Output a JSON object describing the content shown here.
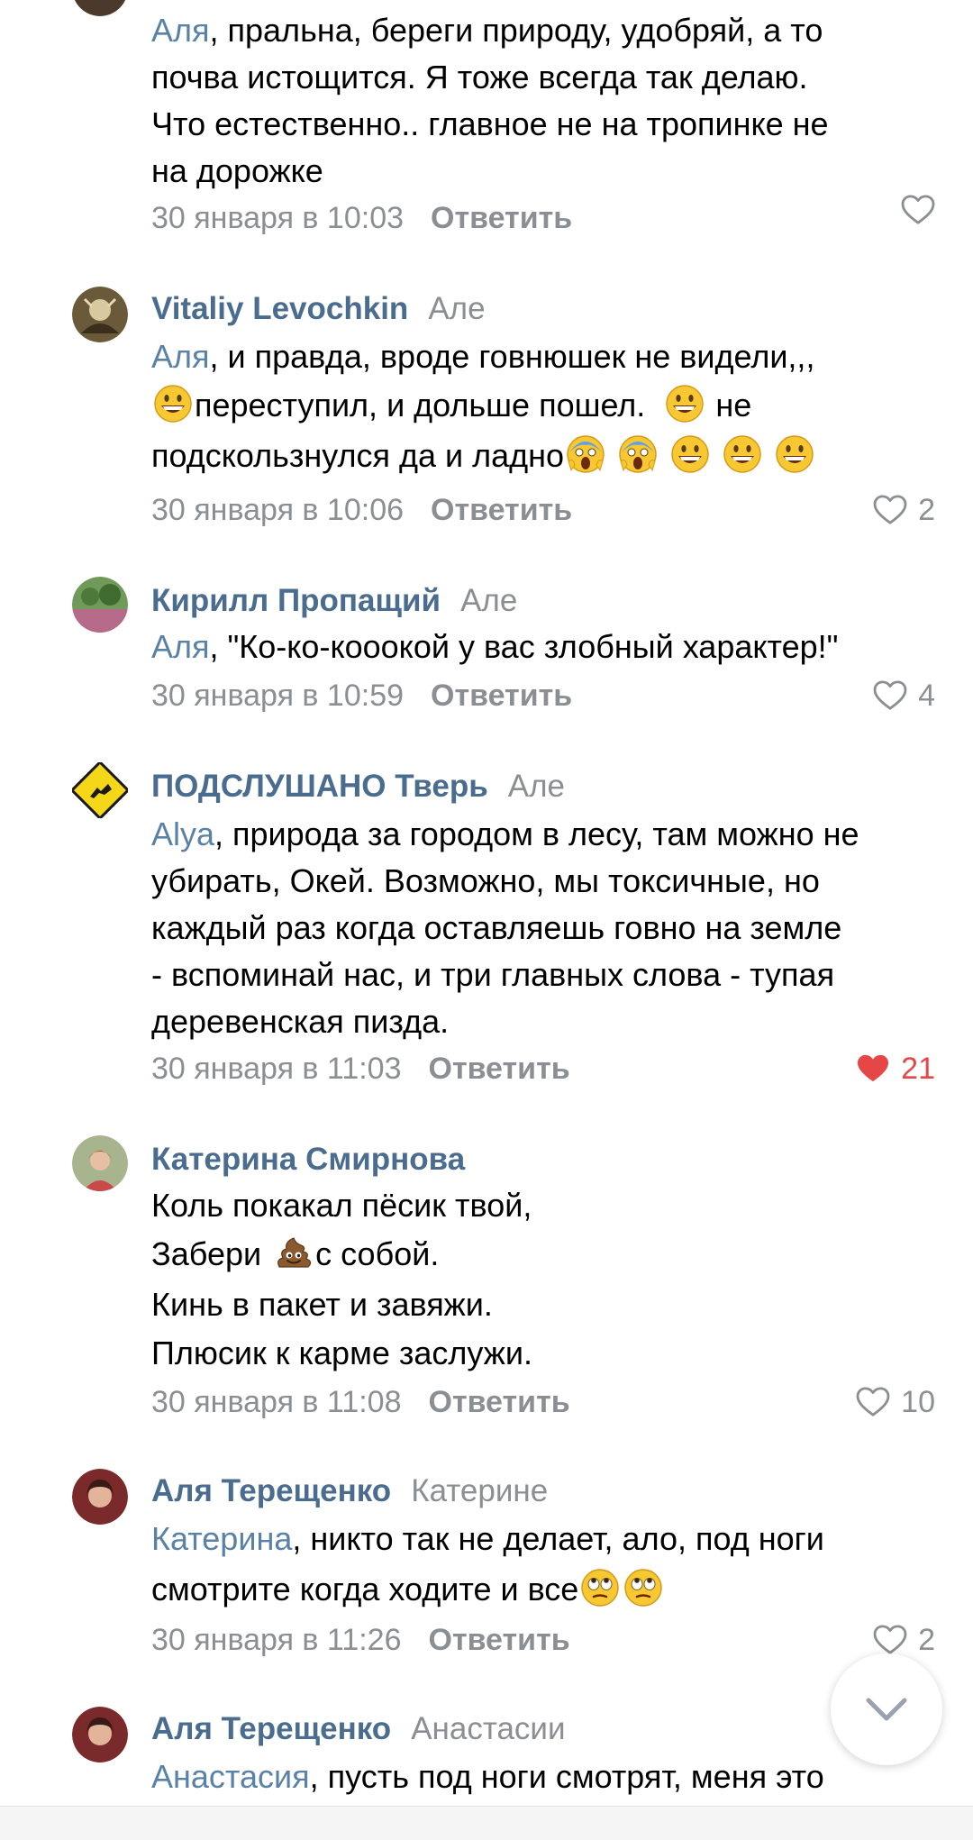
{
  "comments": [
    {
      "text_lines": [
        {
          "mention": "Аля",
          "rest": ", пральна, береги природу, удобряй, а то"
        },
        {
          "text": "почва истощится. Я тоже всегда так делаю."
        },
        {
          "text": "Что естественно.. главное не на тропинке не"
        },
        {
          "text": "на дорожке"
        }
      ],
      "date": "30 января в 10:03",
      "reply_label": "Ответить",
      "likes": ""
    },
    {
      "author": "Vitaliy Levochkin",
      "reply_to": "Але",
      "text_lines": [
        {
          "mention": "Аля",
          "rest": ",  и правда, вроде говнюшек не видели,,,"
        },
        {
          "text": "переступил, и дольше пошел."
        },
        {
          "text": "не"
        },
        {
          "text": "подскользнулся да и ладно"
        }
      ],
      "date": "30 января в 10:06",
      "reply_label": "Ответить",
      "likes": "2"
    },
    {
      "author": "Кирилл Пропащий",
      "reply_to": "Але",
      "text_lines": [
        {
          "mention": "Аля",
          "rest": ", \"Ко-ко-кооокой у вас злобный характер!\""
        }
      ],
      "date": "30 января в 10:59",
      "reply_label": "Ответить",
      "likes": "4"
    },
    {
      "author": "ПОДСЛУШАНО Тверь",
      "reply_to": "Але",
      "text_lines": [
        {
          "mention": "Alya",
          "rest": ", природа за городом в лесу, там можно не"
        },
        {
          "text": "убирать,  Окей. Возможно, мы токсичные, но"
        },
        {
          "text": "каждый раз когда оставляешь говно на земле"
        },
        {
          "text": "- вспоминай нас, и три главных слова - тупая"
        },
        {
          "text": "деревенская пизда."
        }
      ],
      "date": "30 января в 11:03",
      "reply_label": "Ответить",
      "likes": "21",
      "liked": true
    },
    {
      "author": "Катерина Смирнова",
      "reply_to": "",
      "text_lines": [
        {
          "text": "Коль покакал пёсик твой,"
        },
        {
          "text": "Забери"
        },
        {
          "text": "с собой."
        },
        {
          "text": "Кинь в пакет и завяжи."
        },
        {
          "text": "Плюсик к карме заслужи."
        }
      ],
      "date": "30 января в 11:08",
      "reply_label": "Ответить",
      "likes": "10"
    },
    {
      "author": "Аля Терещенко",
      "reply_to": "Катерине",
      "text_lines": [
        {
          "mention": "Катерина",
          "rest": ", никто так не делает, ало, под ноги"
        },
        {
          "text": "смотрите когда ходите и все"
        }
      ],
      "date": "30 января в 11:26",
      "reply_label": "Ответить",
      "likes": "2"
    },
    {
      "author": "Аля Терещенко",
      "reply_to": "Анастасии",
      "text_lines": [
        {
          "mention": "Анастасия",
          "rest": ", пусть под ноги смотрят, меня это"
        }
      ]
    }
  ],
  "icons": {
    "like": "heart-outline-icon",
    "liked": "heart-filled-icon",
    "scroll": "chevron-down-icon"
  },
  "colors": {
    "author": "#4a6c8f",
    "mention": "#5a81a6",
    "meta": "#8b8f94",
    "liked": "#e64646"
  }
}
